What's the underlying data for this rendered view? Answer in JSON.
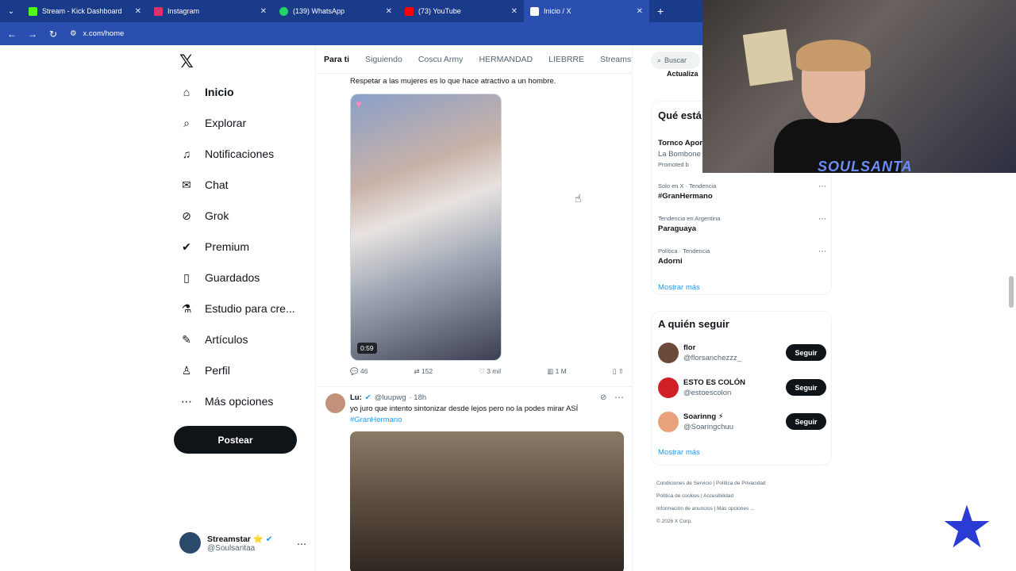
{
  "browser": {
    "tabs": [
      {
        "title": "Stream - Kick Dashboard",
        "color": "#53fc18",
        "active": false
      },
      {
        "title": "Instagram",
        "color": "#e1306c",
        "active": false
      },
      {
        "title": "(139) WhatsApp",
        "color": "#25d366",
        "active": false
      },
      {
        "title": "(73) YouTube",
        "color": "#ff0000",
        "active": false
      },
      {
        "title": "Inicio / X",
        "color": "#ffffff",
        "active": true
      }
    ],
    "url": "x.com/home"
  },
  "sidebar": {
    "logo": "𝕏",
    "items": [
      {
        "label": "Inicio",
        "icon": "home-icon",
        "glyph": "⌂"
      },
      {
        "label": "Explorar",
        "icon": "search-icon",
        "glyph": "⌕"
      },
      {
        "label": "Notificaciones",
        "icon": "bell-icon",
        "glyph": "🔔"
      },
      {
        "label": "Chat",
        "icon": "mail-icon",
        "glyph": "✉"
      },
      {
        "label": "Grok",
        "icon": "grok-icon",
        "glyph": "⊘"
      },
      {
        "label": "Premium",
        "icon": "verified-icon",
        "glyph": "✔"
      },
      {
        "label": "Guardados",
        "icon": "bookmark-icon",
        "glyph": "▯"
      },
      {
        "label": "Estudio para cre...",
        "icon": "flask-icon",
        "glyph": "⚗"
      },
      {
        "label": "Artículos",
        "icon": "article-icon",
        "glyph": "✎"
      },
      {
        "label": "Perfil",
        "icon": "person-icon",
        "glyph": "♙"
      },
      {
        "label": "Más opciones",
        "icon": "more-circle-icon",
        "glyph": "⋯"
      }
    ],
    "post_label": "Postear",
    "profile": {
      "name": "Streamstar",
      "badge": "⭐",
      "handle": "@Soulsantaa"
    }
  },
  "feed": {
    "tabs": [
      "Para ti",
      "Siguiendo",
      "Coscu Army",
      "HERMANDAD",
      "LIEBRRE",
      "Streamst"
    ],
    "tweet1": {
      "text": "Respetar a las mujeres es lo que hace atractivo a un hombre.",
      "duration": "0:59",
      "replies": "46",
      "reposts": "152",
      "likes": "3 mil",
      "views": "1 M"
    },
    "tweet2": {
      "name": "Lu:",
      "handle": "@luupwg",
      "time": "· 18h",
      "text": "yo juro que intento sintonizar desde lejos pero no la podes mirar ASÍ",
      "hashtag": "#GranHermano"
    }
  },
  "right": {
    "search_placeholder": "Buscar",
    "update_label": "Actualiza",
    "trends_title": "Qué está",
    "promoted": {
      "name": "Tornco Apor",
      "sub": "La Bombone",
      "tag": "Promoted b"
    },
    "trends": [
      {
        "context": "Solo en X · Tendencia",
        "name": "#GranHermano"
      },
      {
        "context": "Tendencia en Argentina",
        "name": "Paraguaya"
      },
      {
        "context": "Política · Tendencia",
        "name": "Adorni"
      }
    ],
    "show_more": "Mostrar más",
    "follow_title": "A quién seguir",
    "follow": [
      {
        "name": "flor",
        "handle": "@florsanchezzz_",
        "color": "#6b4a3a"
      },
      {
        "name": "ESTO ES COLÓN",
        "handle": "@estoescolon",
        "color": "#d01f26"
      },
      {
        "name": "Soarinng ⚡",
        "handle": "@Soaringchuu",
        "color": "#e9a17c"
      }
    ],
    "follow_label": "Seguir",
    "footer": [
      "Condiciones de Servicio",
      "Política de Privacidad",
      "Política de cookies",
      "Accesibilidad",
      "Información de anuncios",
      "Más opciones ...",
      "© 2026 X Corp."
    ]
  },
  "overlay": {
    "cam_brand": "SOULSANTA"
  }
}
